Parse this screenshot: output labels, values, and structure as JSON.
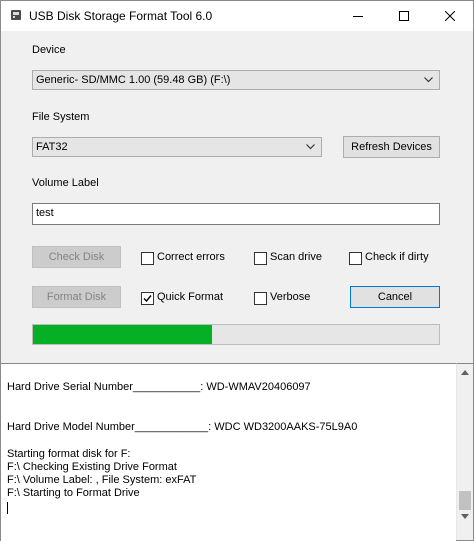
{
  "window": {
    "title": "USB Disk Storage Format Tool 6.0"
  },
  "device": {
    "label": "Device",
    "selected": "Generic-  SD/MMC  1.00 (59.48 GB) (F:\\)"
  },
  "filesystem": {
    "label": "File System",
    "selected": "FAT32",
    "refresh_label": "Refresh Devices"
  },
  "volume": {
    "label": "Volume Label",
    "value": "test"
  },
  "buttons": {
    "check_disk": "Check Disk",
    "format_disk": "Format Disk",
    "cancel": "Cancel"
  },
  "options": {
    "correct_errors": {
      "label": "Correct errors",
      "checked": false
    },
    "scan_drive": {
      "label": "Scan drive",
      "checked": false
    },
    "check_if_dirty": {
      "label": "Check if dirty",
      "checked": false
    },
    "quick_format": {
      "label": "Quick Format",
      "checked": true
    },
    "verbose": {
      "label": "Verbose",
      "checked": false
    }
  },
  "progress": {
    "fraction": 0.44,
    "color": "#06b025"
  },
  "log": {
    "lines": [
      "Hard Drive Serial Number___________:      WD-WMAV20406097",
      "Hard Drive Model Number____________: WDC WD3200AAKS-75L9A0",
      "Starting format disk for F:",
      "F:\\ Checking Existing Drive Format",
      "F:\\ Volume Label: , File System: exFAT",
      "F:\\ Starting to Format Drive"
    ]
  }
}
